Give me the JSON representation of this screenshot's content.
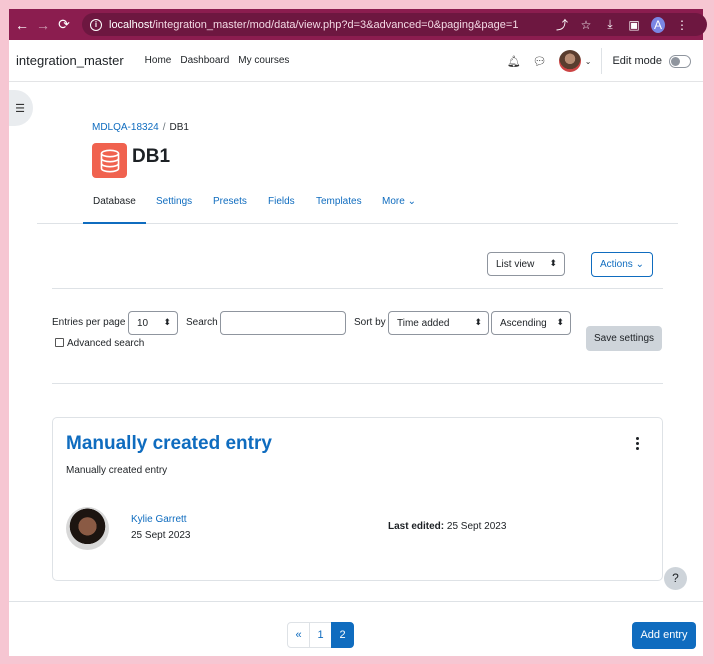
{
  "browser": {
    "url_host": "localhost",
    "url_path": "/integration_master/mod/data/view.php?d=3&advanced=0&paging&page=1",
    "profile_initial": "A"
  },
  "topnav": {
    "brand": "integration_master",
    "links": [
      "Home",
      "Dashboard",
      "My courses"
    ],
    "edit_mode_label": "Edit mode"
  },
  "breadcrumb": {
    "course": "MDLQA-18324",
    "separator": "/",
    "current": "DB1"
  },
  "page_title": "DB1",
  "tabs": [
    "Database",
    "Settings",
    "Presets",
    "Fields",
    "Templates",
    "More"
  ],
  "toolbar": {
    "view_select": "List view",
    "actions": "Actions"
  },
  "filters": {
    "entries_per_page_label": "Entries per page",
    "entries_per_page_value": "10",
    "search_label": "Search",
    "search_value": "",
    "sort_by_label": "Sort by",
    "sort_by_value": "Time added",
    "order_value": "Ascending",
    "advanced_search_label": "Advanced search",
    "save_settings": "Save settings"
  },
  "entry": {
    "title": "Manually created entry",
    "description": "Manually created entry",
    "author": "Kylie Garrett",
    "author_date": "25 Sept 2023",
    "last_edited_label": "Last edited:",
    "last_edited_value": "25 Sept 2023"
  },
  "help": "?",
  "pagination": {
    "prev": "«",
    "pages": [
      "1",
      "2"
    ],
    "current": "2"
  },
  "add_entry": "Add entry",
  "colors": {
    "chrome": "#8b1d4f",
    "primary": "#0f6cbf",
    "db_icon": "#f0624f"
  }
}
